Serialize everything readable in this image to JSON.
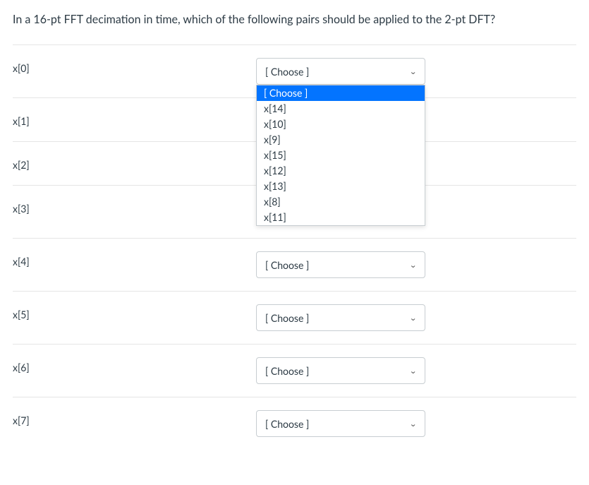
{
  "question": "In a 16-pt FFT decimation in time, which of the following pairs should be applied to the 2-pt DFT?",
  "choose_placeholder": "[ Choose ]",
  "rows": [
    {
      "label": "x[0]",
      "open": true
    },
    {
      "label": "x[1]",
      "open": false
    },
    {
      "label": "x[2]",
      "open": false
    },
    {
      "label": "x[3]",
      "open": false
    },
    {
      "label": "x[4]",
      "open": false
    },
    {
      "label": "x[5]",
      "open": false
    },
    {
      "label": "x[6]",
      "open": false
    },
    {
      "label": "x[7]",
      "open": false
    }
  ],
  "dropdown_options": [
    "[ Choose ]",
    "x[14]",
    "x[10]",
    "x[9]",
    "x[15]",
    "x[12]",
    "x[13]",
    "x[8]",
    "x[11]"
  ]
}
